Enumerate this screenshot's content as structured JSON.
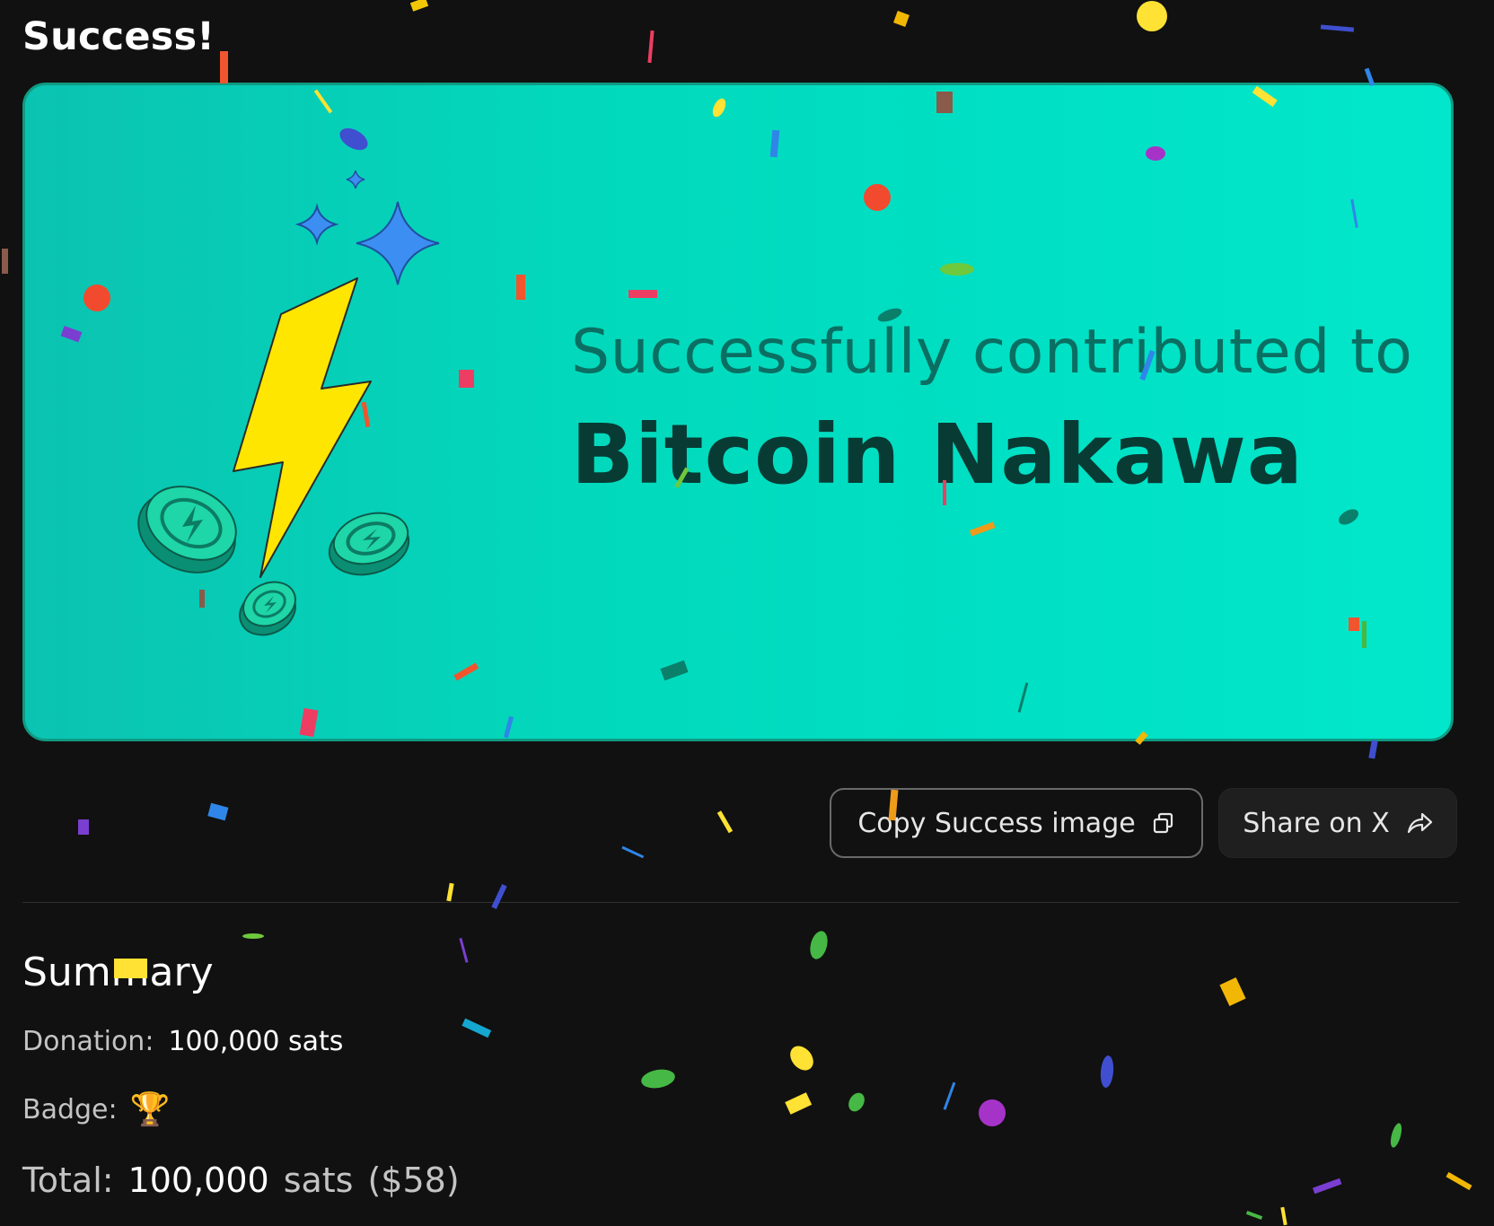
{
  "page": {
    "title": "Success!"
  },
  "card": {
    "line1": "Successfully contributed to",
    "line2": "Bitcoin Nakawa"
  },
  "actions": {
    "copy_label": "Copy Success image",
    "share_label": "Share on X"
  },
  "summary": {
    "heading": "Summary",
    "donation_label": "Donation:",
    "donation_value": "100,000 sats",
    "badge_label": "Badge:",
    "badge_value": "🏆",
    "total_label": "Total:",
    "total_amount": "100,000",
    "total_unit": "sats",
    "total_fiat": "($58)"
  },
  "icons": {
    "copy": "copy-icon",
    "share": "share-arrow-icon",
    "badge": "trophy-icon"
  },
  "colors": {
    "background": "#111111",
    "card_gradient_start": "#0bc3b1",
    "card_gradient_end": "#02e7cb",
    "bolt": "#ffe600",
    "sparkle": "#3d8ef2"
  }
}
